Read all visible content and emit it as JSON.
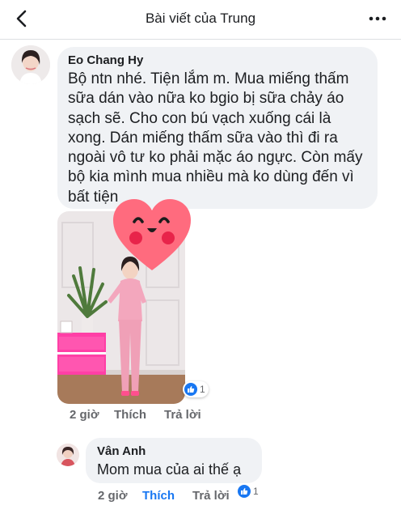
{
  "header": {
    "title": "Bài viết của Trung",
    "back_icon": "chevron-left-icon",
    "more_icon": "more-horizontal-icon"
  },
  "comment1": {
    "author": "Eo Chang Hy",
    "text": "Bộ ntn nhé. Tiện lắm m. Mua miếng thấm sữa dán vào nữa ko bgio bị sữa chảy áo sạch sẽ. Cho con bú vạch xuống cái là xong. Dán miếng thấm sữa vào thì đi ra ngoài vô tư ko phải mặc áo ngực. Còn mấy bộ kia mình mua nhiều mà ko dùng đến vì bất tiện",
    "reaction_count": "1",
    "time": "2 giờ",
    "like_label": "Thích",
    "reply_label": "Trả lời"
  },
  "comment2": {
    "author": "Vân Anh",
    "text": "Mom mua của ai thế ạ",
    "reaction_count": "1",
    "time": "2 giờ",
    "like_label": "Thích",
    "reply_label": "Trả lời"
  },
  "colors": {
    "accent": "#1877f2",
    "bubble": "#f0f2f5",
    "secondary_text": "#65676b",
    "sticker_heart": "#ff6b7e"
  }
}
